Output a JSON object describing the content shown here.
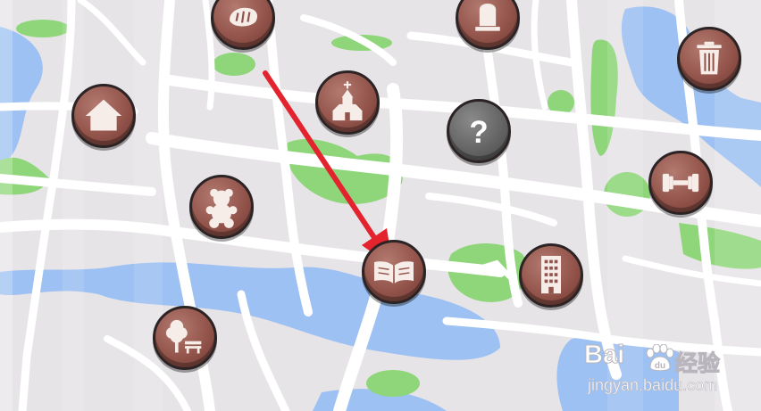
{
  "map": {
    "pins": [
      {
        "name": "bakery-location",
        "icon": "bread-icon"
      },
      {
        "name": "cemetery-location",
        "icon": "tombstone-icon"
      },
      {
        "name": "recycling-location",
        "icon": "trash-can-icon"
      },
      {
        "name": "home-location",
        "icon": "house-icon"
      },
      {
        "name": "church-location",
        "icon": "church-icon"
      },
      {
        "name": "unknown-location",
        "icon": "question-mark-icon",
        "label": "?"
      },
      {
        "name": "gym-location",
        "icon": "dumbbell-icon"
      },
      {
        "name": "toy-store-location",
        "icon": "teddy-bear-icon"
      },
      {
        "name": "library-location",
        "icon": "open-book-icon"
      },
      {
        "name": "office-building-location",
        "icon": "building-icon"
      },
      {
        "name": "park-location",
        "icon": "tree-bench-icon"
      }
    ],
    "annotation": {
      "type": "arrow",
      "color": "#e3232d",
      "points_to": "library-location"
    }
  },
  "colors": {
    "road": "#ffffff",
    "block": "#e6e3e7",
    "water": "#9cc1f2",
    "park": "#8fd67a",
    "pin_fill": "#93544b",
    "pin_unknown_fill": "#656565",
    "pin_border": "#2b2324"
  },
  "watermark": {
    "brand_left": "Bai",
    "brand_right": "经验",
    "url": "jingyan.baidu.com"
  }
}
